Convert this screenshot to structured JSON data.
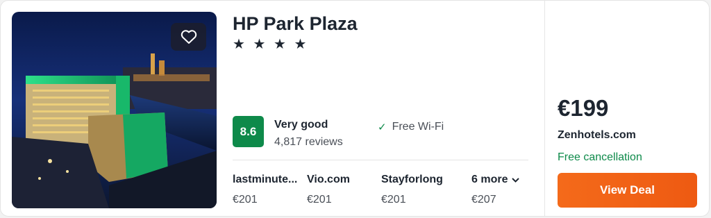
{
  "hotel": {
    "name": "HP Park Plaza",
    "stars": "★ ★ ★ ★",
    "star_count": 4,
    "rating_score": "8.6",
    "rating_label": "Very good",
    "review_count": "4,817 reviews",
    "amenity": "Free Wi-Fi",
    "favorite_icon": "heart-icon"
  },
  "providers": [
    {
      "name": "lastminute...",
      "price": "€201"
    },
    {
      "name": "Vio.com",
      "price": "€201"
    },
    {
      "name": "Stayforlong",
      "price": "€201"
    },
    {
      "name": "6 more",
      "price": "€207"
    }
  ],
  "deal": {
    "price": "€199",
    "provider": "Zenhotels.com",
    "cancellation": "Free cancellation",
    "button_label": "View Deal"
  },
  "colors": {
    "rating_badge": "#0e8a4a",
    "free_cancellation": "#0e8a4a",
    "deal_button": "#f46a1a"
  }
}
